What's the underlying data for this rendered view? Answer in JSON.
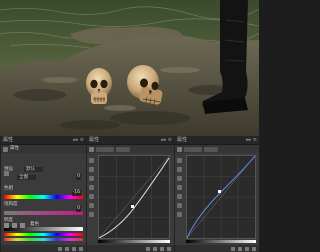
{
  "panels": {
    "hue_sat": {
      "title": "属性",
      "close": "▸▸ ≡",
      "preset_label": "预设",
      "preset_value": "默认",
      "channel_value": "全图",
      "hue_label": "色相",
      "hue_value": "0",
      "sat_label": "饱和度",
      "sat_value": "-16",
      "light_label": "明度",
      "light_value": "0",
      "colorize_label": "着色"
    },
    "curves1": {
      "title": "属性",
      "close": "▸▸ ≡"
    },
    "curves2": {
      "title": "属性",
      "close": "▸▸ ≡"
    }
  },
  "icons": [
    "hue-saturation-icon",
    "curves-icon",
    "eyedropper-icon",
    "pencil-icon",
    "hand-icon"
  ],
  "colors": {
    "panel": "#3b3b3b",
    "header": "#262626",
    "curve_bg": "#2b2b2b"
  }
}
